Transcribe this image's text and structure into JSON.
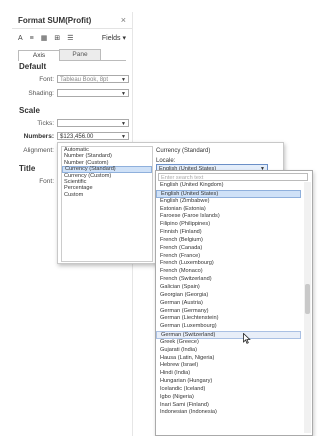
{
  "pane": {
    "title": "Format SUM(Profit)",
    "close": "×",
    "toolbar": {
      "font_icon": "A",
      "align_icon": "≡",
      "shading_icon": "▦",
      "borders_icon": "⊞",
      "lines_icon": "☰",
      "fields_label": "Fields ▾"
    },
    "tabs": [
      "Axis",
      "Pane"
    ],
    "default_section": "Default",
    "font_label": "Font:",
    "font_value": "Tableau Book, 8pt",
    "shading_label": "Shading:",
    "scale_section": "Scale",
    "ticks_label": "Ticks:",
    "numbers_label": "Numbers:",
    "numbers_value": "$123,456.00",
    "alignment_label": "Alignment:",
    "title_section": "Title",
    "title_font_label": "Font:"
  },
  "number_formats": {
    "items": [
      "Automatic",
      "Number (Standard)",
      "Number (Custom)",
      "Currency (Standard)",
      "Currency (Custom)",
      "Scientific",
      "Percentage",
      "Custom"
    ],
    "selected_index": 3
  },
  "currency": {
    "header": "Currency (Standard)",
    "locale_label": "Locale:",
    "locale_value": "English (United States)"
  },
  "locale_dropdown": {
    "search_placeholder": "Enter search text",
    "items": [
      "English (United Kingdom)",
      "English (United States)",
      "English (Zimbabwe)",
      "Estonian (Estonia)",
      "Faroese (Faroe Islands)",
      "Filipino (Philippines)",
      "Finnish (Finland)",
      "French (Belgium)",
      "French (Canada)",
      "French (France)",
      "French (Luxembourg)",
      "French (Monaco)",
      "French (Switzerland)",
      "Galician (Spain)",
      "Georgian (Georgia)",
      "German (Austria)",
      "German (Germany)",
      "German (Liechtenstein)",
      "German (Luxembourg)",
      "German (Switzerland)",
      "Greek (Greece)",
      "Gujarati (India)",
      "Hausa (Latin, Nigeria)",
      "Hebrew (Israel)",
      "Hindi (India)",
      "Hungarian (Hungary)",
      "Icelandic (Iceland)",
      "Igbo (Nigeria)",
      "Inari Sami (Finland)",
      "Indonesian (Indonesia)"
    ],
    "selected_index": 1,
    "hovered_index": 19
  }
}
